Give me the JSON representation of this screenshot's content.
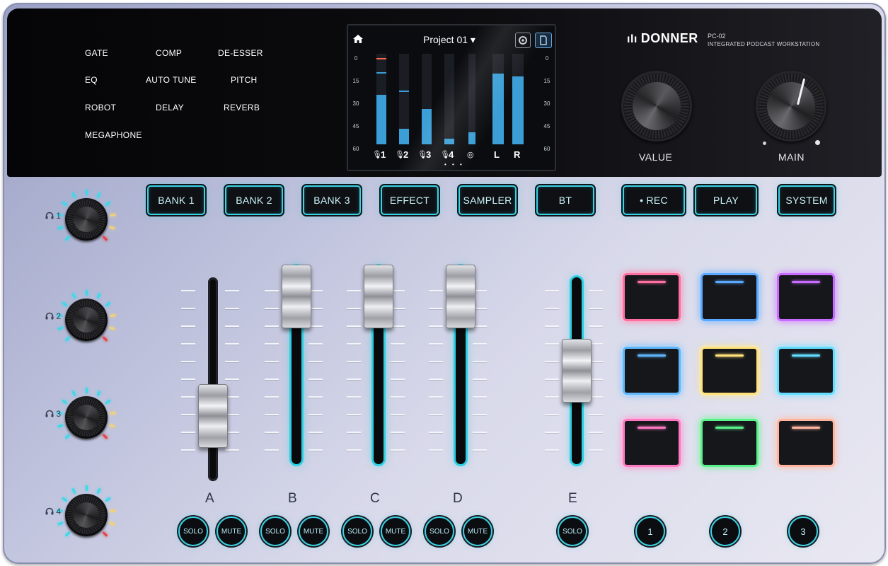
{
  "effects": {
    "gate": "GATE",
    "comp": "COMP",
    "de_esser": "DE-ESSER",
    "eq": "EQ",
    "auto_tune": "AUTO TUNE",
    "pitch": "PITCH",
    "robot": "ROBOT",
    "delay": "DELAY",
    "reverb": "REVERB",
    "megaphone": "MEGAPHONE"
  },
  "screen": {
    "project": "Project 01 ▾",
    "scale_left": [
      "0",
      "15",
      "30",
      "45",
      "60"
    ],
    "scale_right": [
      "0",
      "15",
      "30",
      "45",
      "60"
    ],
    "channels": [
      "1",
      "2",
      "3",
      "4",
      "",
      "L",
      "R"
    ],
    "levels": [
      0.55,
      0.17,
      0.39,
      0.06,
      0.13,
      0.78,
      0.75
    ],
    "meter_color": "#3b9ed6",
    "page_dots": "• • •"
  },
  "brand": {
    "logo": "DONNER",
    "model": "PC-02",
    "tagline": "INTEGRATED PODCAST WORKSTATION"
  },
  "knobs": {
    "value_label": "VALUE",
    "main_label": "MAIN",
    "headphones": [
      "1",
      "2",
      "3",
      "4"
    ]
  },
  "buttons": {
    "bank1": "BANK 1",
    "bank2": "BANK 2",
    "bank3": "BANK 3",
    "effect": "EFFECT",
    "sampler": "SAMPLER",
    "bt": "BT",
    "rec": "• REC",
    "play": "PLAY",
    "system": "SYSTEM"
  },
  "channels": {
    "a": "A",
    "b": "B",
    "c": "C",
    "d": "D",
    "e": "E",
    "fader_levels": [
      0.25,
      1.0,
      1.0,
      1.0,
      0.45
    ]
  },
  "round_buttons": {
    "solo": "SOLO",
    "mute": "MUTE",
    "one": "1",
    "two": "2",
    "three": "3"
  },
  "pads": {
    "colors": [
      "#ff6fa0",
      "#5aa8ff",
      "#c86bff",
      "#5fb8ff",
      "#ffe27a",
      "#62dcff",
      "#ff79c2",
      "#5af08a",
      "#ffb4a0"
    ]
  },
  "accent": "#37d3e6"
}
